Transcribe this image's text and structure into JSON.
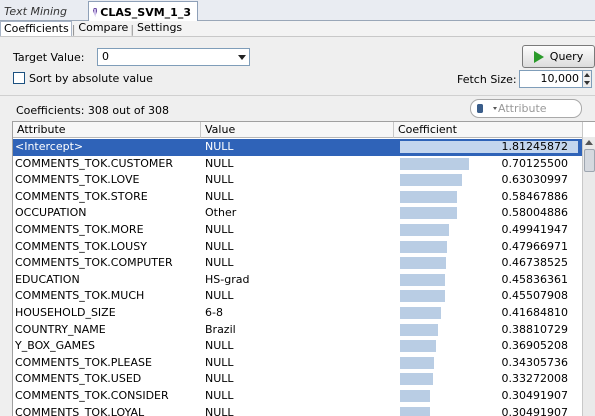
{
  "tabs": [
    {
      "label": "Text Mining",
      "icon": "grid-icon"
    },
    {
      "label": "CLAS_SVM_1_3",
      "icon": "model-icon"
    }
  ],
  "subtabs": [
    "Coefficients",
    "Compare",
    "Settings"
  ],
  "target_value": {
    "label": "Target Value:",
    "value": "0"
  },
  "sort_checkbox": {
    "label": "Sort by absolute value",
    "checked": false
  },
  "query_button": {
    "label": "Query"
  },
  "fetch_size": {
    "label": "Fetch Size:",
    "value": "10,000"
  },
  "coefficients_count": "Coefficients: 308 out of 308",
  "filter": {
    "placeholder": "Attribute"
  },
  "columns": [
    "Attribute",
    "Value",
    "Coefficient"
  ],
  "rows": [
    {
      "attribute": "<Intercept>",
      "value": "NULL",
      "coefficient": "1.81245872",
      "selected": true
    },
    {
      "attribute": "COMMENTS_TOK.CUSTOMER",
      "value": "NULL",
      "coefficient": "0.70125500"
    },
    {
      "attribute": "COMMENTS_TOK.LOVE",
      "value": "NULL",
      "coefficient": "0.63030997"
    },
    {
      "attribute": "COMMENTS_TOK.STORE",
      "value": "NULL",
      "coefficient": "0.58467886"
    },
    {
      "attribute": "OCCUPATION",
      "value": "Other",
      "coefficient": "0.58004886"
    },
    {
      "attribute": "COMMENTS_TOK.MORE",
      "value": "NULL",
      "coefficient": "0.49941947"
    },
    {
      "attribute": "COMMENTS_TOK.LOUSY",
      "value": "NULL",
      "coefficient": "0.47966971"
    },
    {
      "attribute": "COMMENTS_TOK.COMPUTER",
      "value": "NULL",
      "coefficient": "0.46738525"
    },
    {
      "attribute": "EDUCATION",
      "value": "HS-grad",
      "coefficient": "0.45836361"
    },
    {
      "attribute": "COMMENTS_TOK.MUCH",
      "value": "NULL",
      "coefficient": "0.45507908"
    },
    {
      "attribute": "HOUSEHOLD_SIZE",
      "value": "6-8",
      "coefficient": "0.41684810"
    },
    {
      "attribute": "COUNTRY_NAME",
      "value": "Brazil",
      "coefficient": "0.38810729"
    },
    {
      "attribute": "Y_BOX_GAMES",
      "value": "NULL",
      "coefficient": "0.36905208"
    },
    {
      "attribute": "COMMENTS_TOK.PLEASE",
      "value": "NULL",
      "coefficient": "0.34305736"
    },
    {
      "attribute": "COMMENTS_TOK.USED",
      "value": "NULL",
      "coefficient": "0.33272008"
    },
    {
      "attribute": "COMMENTS_TOK.CONSIDER",
      "value": "NULL",
      "coefficient": "0.30491907"
    },
    {
      "attribute": "COMMENTS_TOK.LOYAL",
      "value": "NULL",
      "coefficient": "0.30491907"
    }
  ],
  "colors": {
    "selection": "#2f63b8",
    "bar": "#b9cde4"
  }
}
